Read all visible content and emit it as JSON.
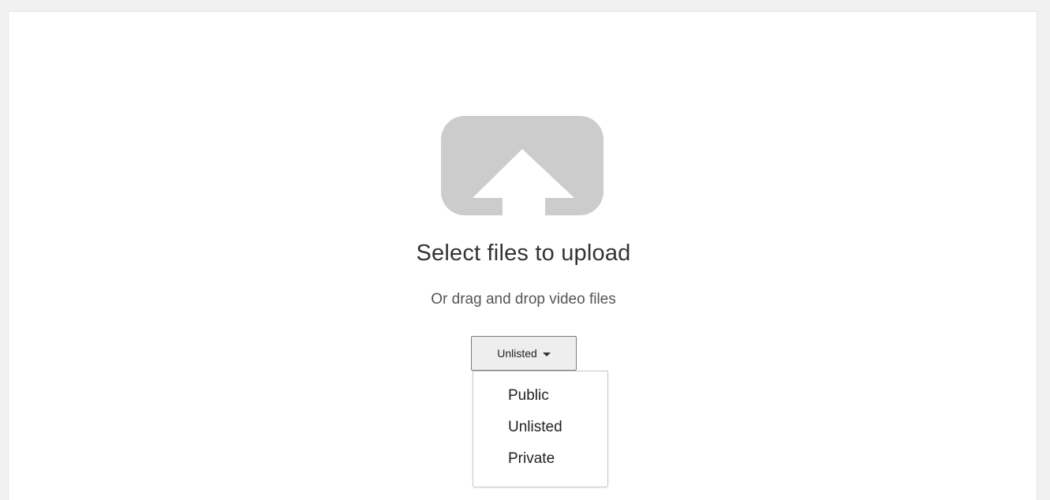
{
  "upload": {
    "icon": "upload-arrow-icon",
    "icon_color": "#cccccc",
    "title": "Select files to upload",
    "subtitle": "Or drag and drop video files"
  },
  "privacy": {
    "selected": "Unlisted",
    "caret_icon": "caret-down-icon",
    "options": [
      "Public",
      "Unlisted",
      "Private"
    ]
  }
}
